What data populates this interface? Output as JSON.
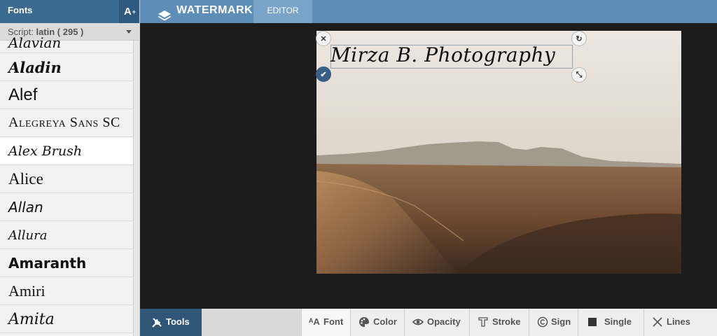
{
  "sidebar": {
    "title": "Fonts",
    "add_button": "A",
    "add_button_sup": "+",
    "filter_prefix": "Script:",
    "filter_value": "latin ( 295 )",
    "fonts": [
      "Aladin",
      "Alef",
      "Alegreya Sans SC",
      "Alex Brush",
      "Alice",
      "Allan",
      "Allura",
      "Amaranth",
      "Amiri",
      "Amita"
    ],
    "selected_font": "Alex Brush"
  },
  "topbar": {
    "brand": "WATERMARK",
    "tab": "EDITOR"
  },
  "canvas": {
    "watermark_text": "Mirza B. Photography"
  },
  "toolbar": {
    "tools_label": "Tools",
    "items": [
      "Font",
      "Color",
      "Opacity",
      "Stroke",
      "Sign",
      "Single",
      "Lines"
    ],
    "active_item": "Font"
  },
  "colors": {
    "header_blue": "#3b6a93",
    "topbar_blue": "#5e8db8",
    "tools_blue": "#2f5676",
    "canvas_bg": "#1c1c1c"
  }
}
